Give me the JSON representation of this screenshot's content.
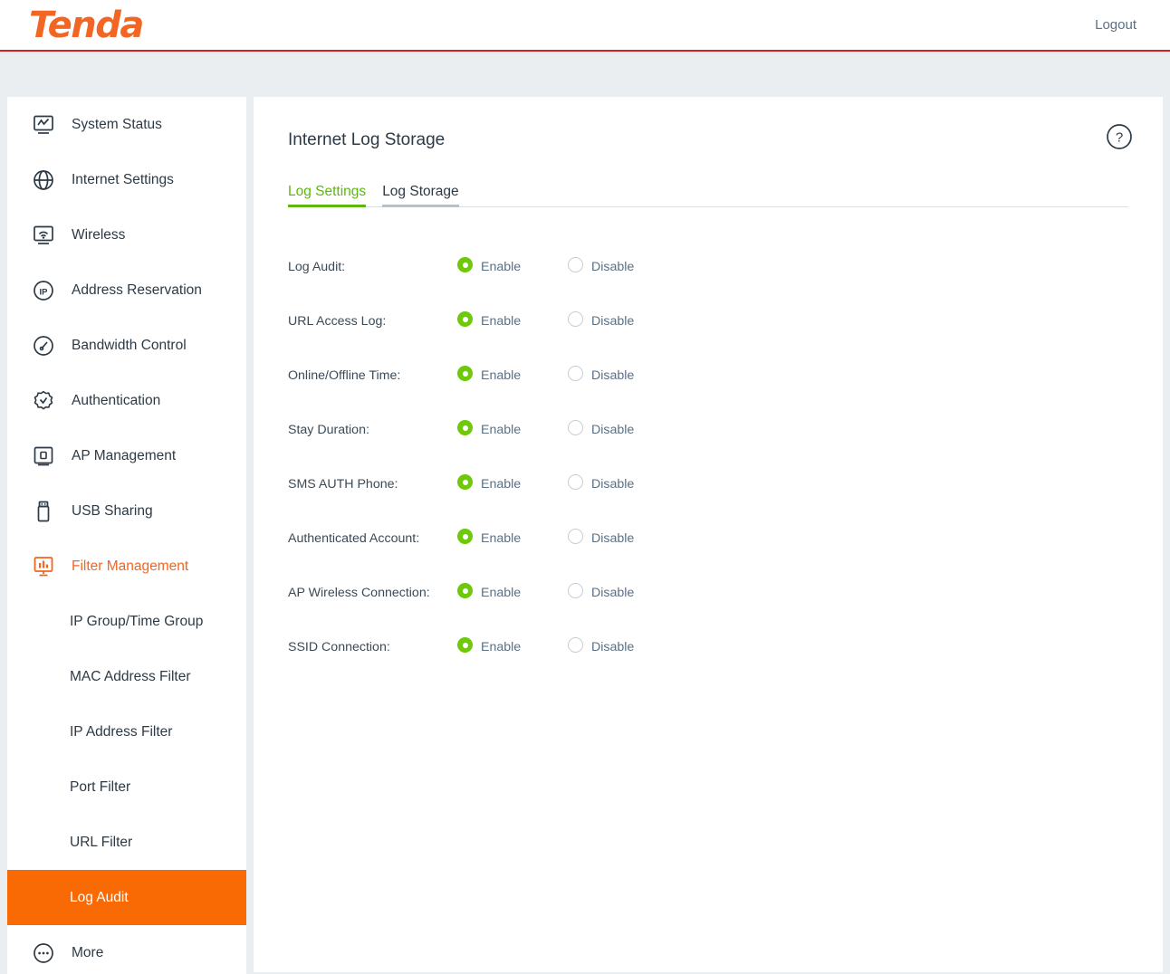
{
  "header": {
    "brand": "Tenda",
    "logout_label": "Logout",
    "brand_color": "#f26522",
    "rule_color": "#d12027"
  },
  "sidebar": {
    "items": [
      {
        "label": "System Status",
        "icon": "monitor-chart-icon",
        "type": "top",
        "state": "normal"
      },
      {
        "label": "Internet Settings",
        "icon": "globe-icon",
        "type": "top",
        "state": "normal"
      },
      {
        "label": "Wireless",
        "icon": "wireless-monitor-icon",
        "type": "top",
        "state": "normal"
      },
      {
        "label": "Address Reservation",
        "icon": "ip-circle-icon",
        "type": "top",
        "state": "normal"
      },
      {
        "label": "Bandwidth Control",
        "icon": "gauge-icon",
        "type": "top",
        "state": "normal"
      },
      {
        "label": "Authentication",
        "icon": "badge-check-icon",
        "type": "top",
        "state": "normal"
      },
      {
        "label": "AP Management",
        "icon": "ap-device-icon",
        "type": "top",
        "state": "normal"
      },
      {
        "label": "USB Sharing",
        "icon": "usb-drive-icon",
        "type": "top",
        "state": "normal"
      },
      {
        "label": "Filter Management",
        "icon": "filter-chart-icon",
        "type": "top",
        "state": "expanded"
      },
      {
        "label": "IP Group/Time Group",
        "icon": "",
        "type": "sub",
        "state": "normal"
      },
      {
        "label": "MAC Address Filter",
        "icon": "",
        "type": "sub",
        "state": "normal"
      },
      {
        "label": "IP Address Filter",
        "icon": "",
        "type": "sub",
        "state": "normal"
      },
      {
        "label": "Port Filter",
        "icon": "",
        "type": "sub",
        "state": "normal"
      },
      {
        "label": "URL Filter",
        "icon": "",
        "type": "sub",
        "state": "normal"
      },
      {
        "label": "Log Audit",
        "icon": "",
        "type": "sub",
        "state": "selected"
      },
      {
        "label": "More",
        "icon": "more-dots-icon",
        "type": "top",
        "state": "normal"
      }
    ],
    "active_color": "#f96a05",
    "parent_active_color": "#f26522"
  },
  "main": {
    "title": "Internet Log Storage",
    "help_icon": "help-question-icon",
    "tabs": [
      {
        "label": "Log Settings",
        "active": true
      },
      {
        "label": "Log Storage",
        "active": false
      }
    ],
    "active_tab_color": "#5cb811",
    "enable_label": "Enable",
    "disable_label": "Disable",
    "rows": [
      {
        "label": "Log Audit:",
        "value": "Enable"
      },
      {
        "label": "URL Access Log:",
        "value": "Enable"
      },
      {
        "label": "Online/Offline Time:",
        "value": "Enable"
      },
      {
        "label": "Stay Duration:",
        "value": "Enable"
      },
      {
        "label": "SMS AUTH Phone:",
        "value": "Enable"
      },
      {
        "label": "Authenticated Account:",
        "value": "Enable"
      },
      {
        "label": "AP Wireless Connection:",
        "value": "Enable"
      },
      {
        "label": "SSID Connection:",
        "value": "Enable"
      }
    ]
  }
}
